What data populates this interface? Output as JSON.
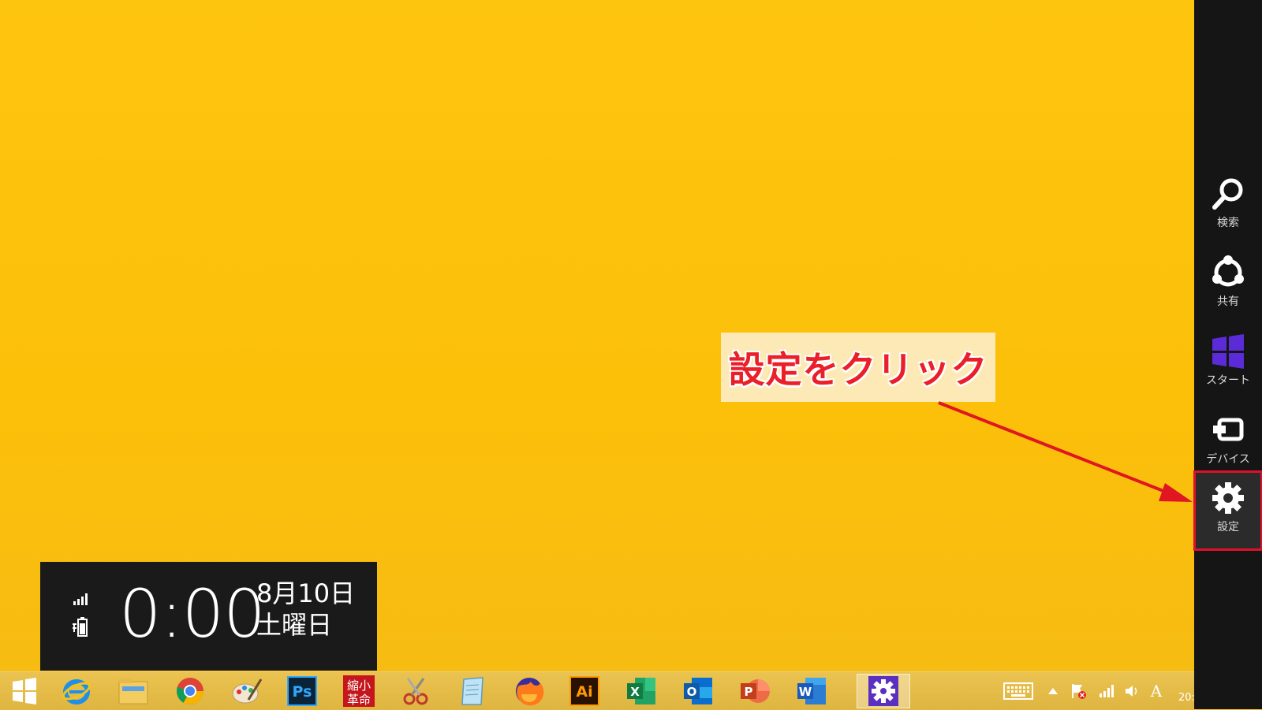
{
  "charms": {
    "items": [
      {
        "label": "検索",
        "icon": "search-icon"
      },
      {
        "label": "共有",
        "icon": "share-icon"
      },
      {
        "label": "スタート",
        "icon": "windows-logo-icon"
      },
      {
        "label": "デバイス",
        "icon": "devices-icon"
      },
      {
        "label": "設定",
        "icon": "gear-icon",
        "selected": true
      }
    ]
  },
  "annotation": {
    "text": "設定をクリック",
    "color": "#ea1f29"
  },
  "clock": {
    "time": "0:00",
    "date_line1": "8月10日",
    "date_line2": "土曜日"
  },
  "taskbar": {
    "apps": [
      {
        "name": "start-button",
        "icon": "windows-start-icon"
      },
      {
        "name": "internet-explorer",
        "icon": "internet-explorer-icon"
      },
      {
        "name": "file-explorer",
        "icon": "folder-icon"
      },
      {
        "name": "chrome",
        "icon": "chrome-icon"
      },
      {
        "name": "paint",
        "icon": "paint-palette-icon"
      },
      {
        "name": "photoshop",
        "icon": "photoshop-icon",
        "text": "Ps"
      },
      {
        "name": "shukusho-kakumei",
        "icon": "shukusho-kakumei-icon",
        "text": "縮小革命"
      },
      {
        "name": "snipping-tool",
        "icon": "scissors-icon"
      },
      {
        "name": "notepad",
        "icon": "notepad-icon"
      },
      {
        "name": "firefox",
        "icon": "firefox-icon"
      },
      {
        "name": "illustrator",
        "icon": "illustrator-icon",
        "text": "Ai"
      },
      {
        "name": "excel",
        "icon": "excel-icon",
        "text": "X"
      },
      {
        "name": "outlook",
        "icon": "outlook-icon",
        "text": "O"
      },
      {
        "name": "powerpoint",
        "icon": "powerpoint-icon",
        "text": "P"
      },
      {
        "name": "word",
        "icon": "word-icon",
        "text": "W"
      },
      {
        "name": "settings",
        "icon": "gear-icon",
        "active": true
      }
    ],
    "tray": {
      "ime_mode": "A",
      "clock_partial": "20:"
    }
  },
  "colors": {
    "desktop": "#fcc009",
    "charms_bg": "#151515",
    "highlight": "#e0102a"
  }
}
